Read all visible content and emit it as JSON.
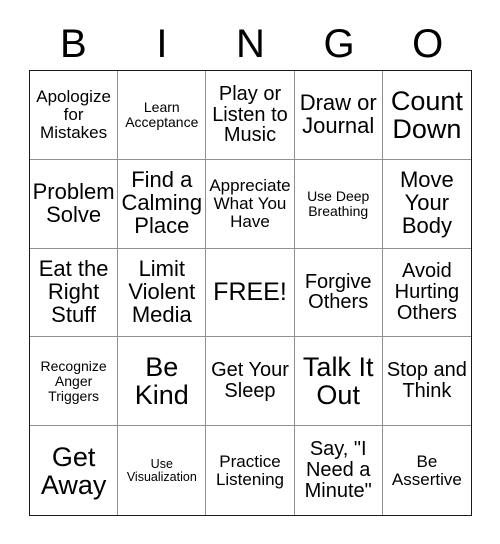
{
  "card": {
    "title": "BINGO",
    "header_letters": [
      "B",
      "I",
      "N",
      "G",
      "O"
    ],
    "free_space_label": "FREE!",
    "grid_size": "5x5",
    "colors": {
      "background": "#ffffff",
      "text": "#000000",
      "outer_border": "#1a1a1a",
      "inner_border": "#909090"
    },
    "cells": [
      {
        "text": "Apologize for Mistakes",
        "size": "sm"
      },
      {
        "text": "Learn Acceptance",
        "size": "xs"
      },
      {
        "text": "Play or Listen to Music",
        "size": "md"
      },
      {
        "text": "Draw or Journal",
        "size": "lg"
      },
      {
        "text": "Count Down",
        "size": "xxl"
      },
      {
        "text": "Problem Solve",
        "size": "lg"
      },
      {
        "text": "Find a Calming Place",
        "size": "lg"
      },
      {
        "text": "Appreciate What You Have",
        "size": "sm"
      },
      {
        "text": "Use Deep Breathing",
        "size": "xs"
      },
      {
        "text": "Move Your Body",
        "size": "lg"
      },
      {
        "text": "Eat the Right Stuff",
        "size": "lg"
      },
      {
        "text": "Limit Violent Media",
        "size": "lg"
      },
      {
        "text": "FREE!",
        "size": "xl"
      },
      {
        "text": "Forgive Others",
        "size": "md"
      },
      {
        "text": "Avoid Hurting Others",
        "size": "md"
      },
      {
        "text": "Recognize Anger Triggers",
        "size": "xs"
      },
      {
        "text": "Be Kind",
        "size": "xxl"
      },
      {
        "text": "Get Your Sleep",
        "size": "md"
      },
      {
        "text": "Talk It Out",
        "size": "xxl"
      },
      {
        "text": "Stop and Think",
        "size": "md"
      },
      {
        "text": "Get Away",
        "size": "xxl"
      },
      {
        "text": "Use Visualization",
        "size": "xxs"
      },
      {
        "text": "Practice Listening",
        "size": "sm"
      },
      {
        "text": "Say, \"I Need a Minute\"",
        "size": "md"
      },
      {
        "text": "Be Assertive",
        "size": "sm"
      }
    ]
  }
}
